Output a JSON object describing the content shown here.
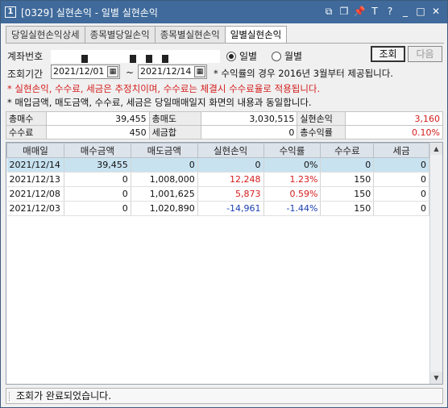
{
  "window": {
    "number_badge": "1",
    "title": "[0329] 실현손익 - 일별 실현손익",
    "icons": [
      "window-icon",
      "copy-icon",
      "pin-icon",
      "text-icon",
      "help-icon",
      "minimize-icon",
      "maximize-icon",
      "close-icon"
    ],
    "icon_glyphs": [
      "⧉",
      "❐",
      "📌",
      "T",
      "?",
      "_",
      "□",
      "✕"
    ]
  },
  "tabs": [
    {
      "label": "당일실현손익상세",
      "active": false
    },
    {
      "label": "종목별당일손익",
      "active": false
    },
    {
      "label": "종목별실현손익",
      "active": false
    },
    {
      "label": "일별실현손익",
      "active": true
    }
  ],
  "filters": {
    "account_label": "계좌번호",
    "period_label": "조회기간",
    "date_from": "2021/12/01",
    "tilde": "~",
    "date_to": "2021/12/14",
    "calendar_glyph": "▦",
    "yield_note": "* 수익률의 경우 2016년 3월부터 제공됩니다.",
    "radio_daily": "일별",
    "radio_monthly": "월별",
    "radio_selected": "일별",
    "btn_query": "조회",
    "btn_next": "다음"
  },
  "notes": {
    "warning": "* 실현손익, 수수료, 세금은 추정치이며, 수수료는 체결시 수수료율로 적용됩니다.",
    "info": "* 매입금액, 매도금액, 수수료, 세금은 당일매매일지 화면의 내용과 동일합니다."
  },
  "summary": {
    "row1": [
      {
        "label": "총매수",
        "value": "39,455"
      },
      {
        "label": "총매도",
        "value": "3,030,515"
      },
      {
        "label": "실현손익",
        "value": "3,160",
        "color": "#d41c1c"
      }
    ],
    "row2": [
      {
        "label": "수수료",
        "value": "450"
      },
      {
        "label": "세금합",
        "value": "0"
      },
      {
        "label": "총수익률",
        "value": "0.10%",
        "color": "#d41c1c"
      }
    ]
  },
  "grid": {
    "headers": [
      "매매일",
      "매수금액",
      "매도금액",
      "실현손익",
      "수익률",
      "수수료",
      "세금"
    ],
    "rows": [
      {
        "date": "2021/12/14",
        "buy": "39,455",
        "sell": "0",
        "pnl": "0",
        "rate": "0%",
        "fee": "0",
        "tax": "0",
        "sign": "zero",
        "selected": true
      },
      {
        "date": "2021/12/13",
        "buy": "0",
        "sell": "1,008,000",
        "pnl": "12,248",
        "rate": "1.23%",
        "fee": "150",
        "tax": "0",
        "sign": "pos",
        "selected": false
      },
      {
        "date": "2021/12/08",
        "buy": "0",
        "sell": "1,001,625",
        "pnl": "5,873",
        "rate": "0.59%",
        "fee": "150",
        "tax": "0",
        "sign": "pos",
        "selected": false
      },
      {
        "date": "2021/12/03",
        "buy": "0",
        "sell": "1,020,890",
        "pnl": "-14,961",
        "rate": "-1.44%",
        "fee": "150",
        "tax": "0",
        "sign": "neg",
        "selected": false
      }
    ],
    "scroll_up": "▲",
    "scroll_down": "▼"
  },
  "status": {
    "message": "조회가 완료되었습니다."
  },
  "colors": {
    "titlebar": "#3f6a9b",
    "positive": "#d41c1c",
    "negative": "#1a3fb0",
    "selected_row": "#c8e2f0"
  }
}
